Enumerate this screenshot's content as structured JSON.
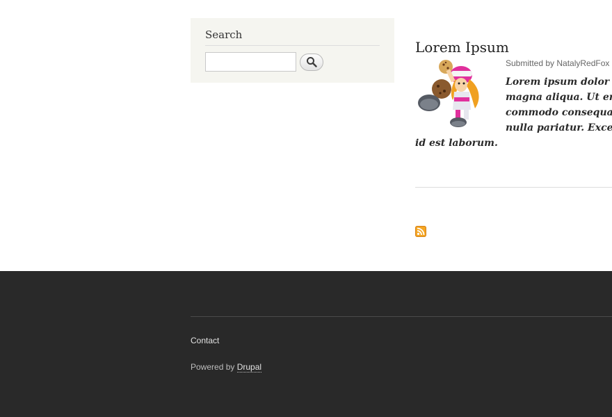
{
  "search": {
    "title": "Search",
    "input_value": "",
    "button_icon": "search-icon"
  },
  "article": {
    "title": "Lorem Ipsum",
    "submitted": "Submitted by NatalyRedFox",
    "teaser_lines": [
      "Lorem ipsum dolor si",
      "magna aliqua. Ut eni",
      "commodo consequat.",
      "nulla pariatur. Excep",
      "id est laborum."
    ],
    "image_alt": "cartoon-girl-with-cookie"
  },
  "feed": {
    "icon": "rss-icon",
    "color": "#f5a623"
  },
  "footer": {
    "contact_label": "Contact",
    "powered_prefix": "Powered by",
    "powered_link": "Drupal",
    "background": "#292929"
  }
}
